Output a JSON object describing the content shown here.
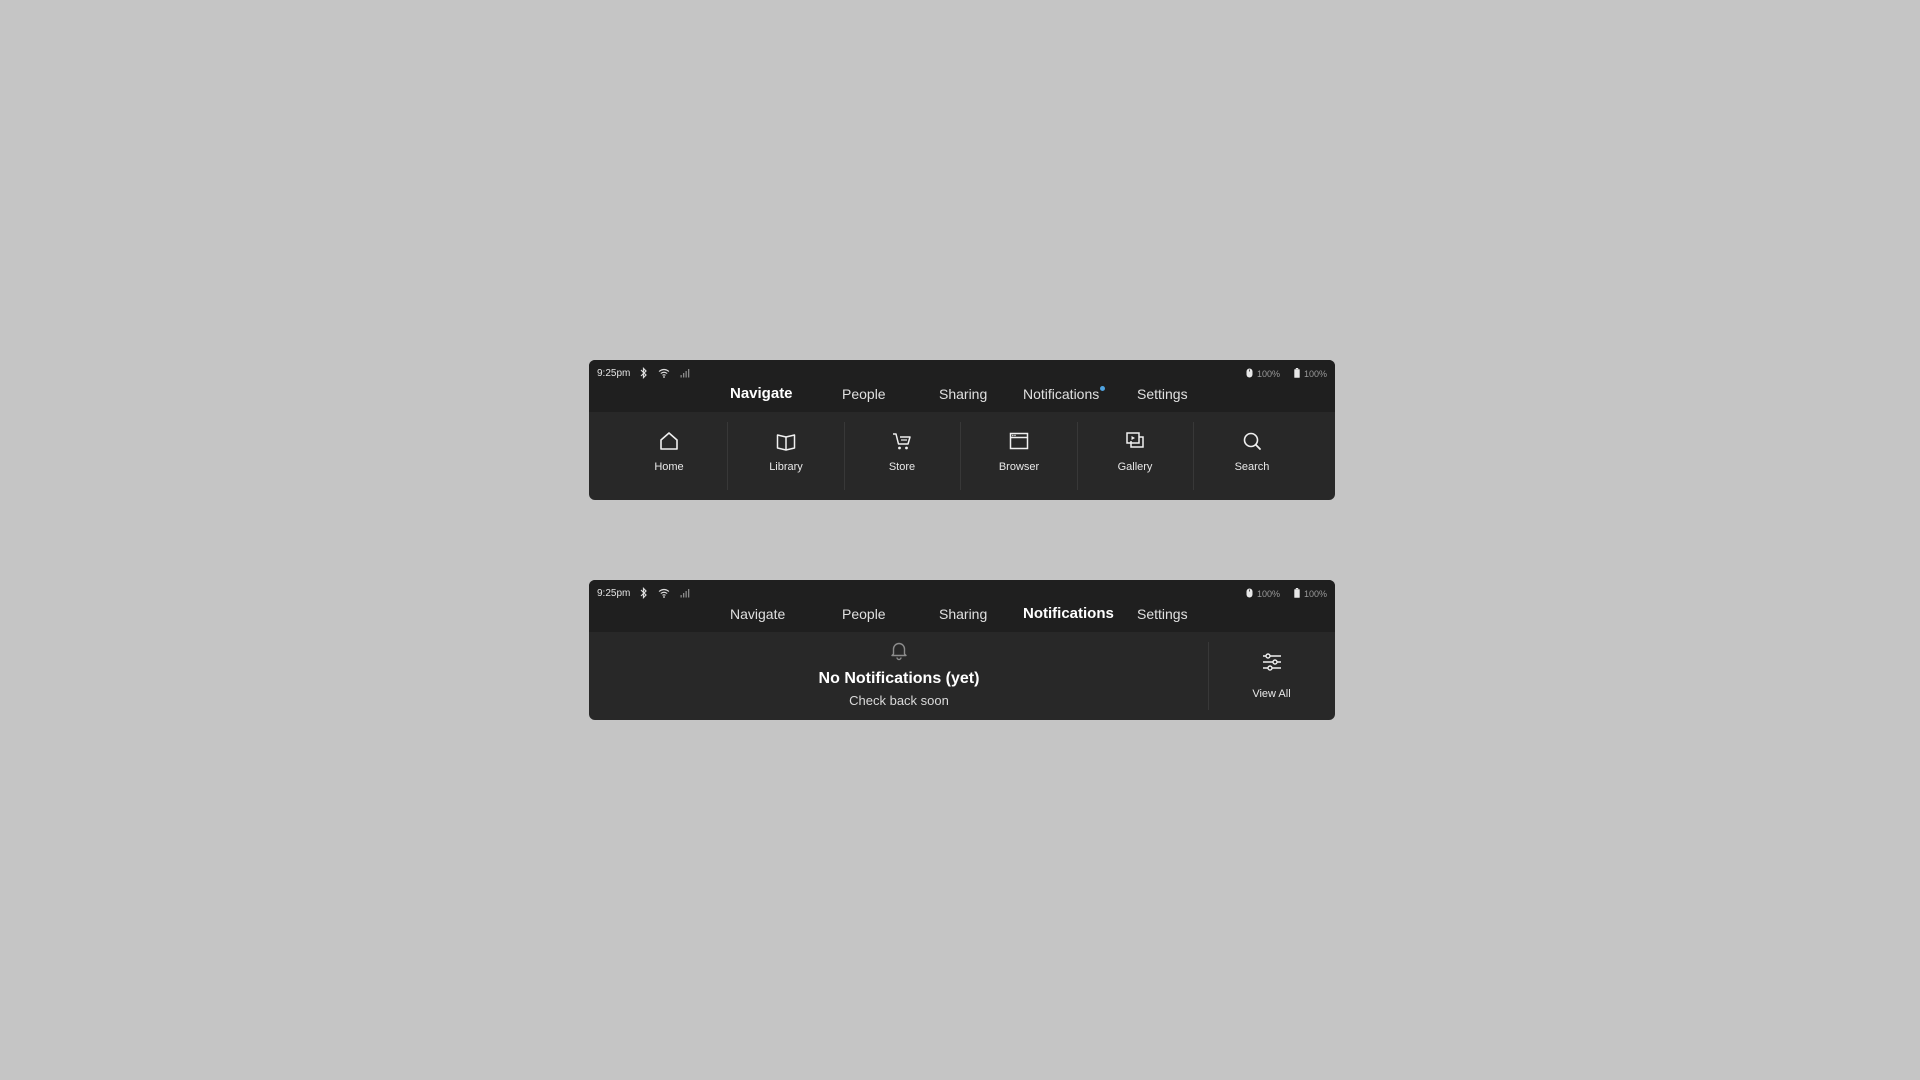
{
  "status": {
    "time": "9:25pm",
    "device_battery": "100%",
    "phone_battery": "100%"
  },
  "tabs": [
    {
      "label": "Navigate"
    },
    {
      "label": "People"
    },
    {
      "label": "Sharing"
    },
    {
      "label": "Notifications"
    },
    {
      "label": "Settings"
    }
  ],
  "panel_navigate": {
    "active_tab": "Navigate",
    "notification_dot_color": "#4fa3e0",
    "items": [
      {
        "label": "Home",
        "icon": "home-icon"
      },
      {
        "label": "Library",
        "icon": "book-icon"
      },
      {
        "label": "Store",
        "icon": "cart-icon"
      },
      {
        "label": "Browser",
        "icon": "browser-window-icon"
      },
      {
        "label": "Gallery",
        "icon": "gallery-icon"
      },
      {
        "label": "Search",
        "icon": "search-icon"
      }
    ]
  },
  "panel_notifications": {
    "active_tab": "Notifications",
    "empty_title": "No Notifications (yet)",
    "empty_subtitle": "Check back soon",
    "view_all_label": "View All"
  },
  "colors": {
    "background": "#c5c5c5",
    "panel": "#282828",
    "header": "#1f1f1f",
    "accent_dot": "#4fa3e0"
  }
}
